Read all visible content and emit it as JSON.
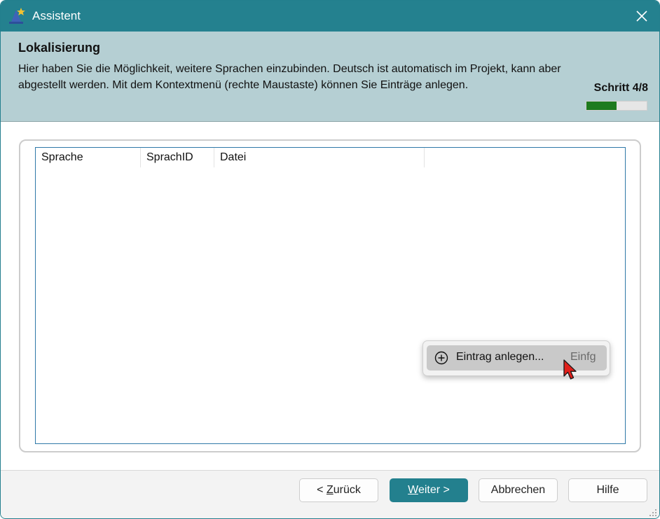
{
  "window": {
    "title": "Assistent",
    "app_icon": "wizard-hat-icon",
    "close_icon": "close-icon"
  },
  "header": {
    "title": "Lokalisierung",
    "description": "Hier haben Sie die Möglichkeit, weitere Sprachen einzubinden. Deutsch ist automatisch im Projekt, kann aber abgestellt werden. Mit dem Kontextmenü (rechte Maustaste) können Sie Einträge anlegen.",
    "step_label": "Schritt 4/8",
    "progress": {
      "current": 4,
      "total": 8
    }
  },
  "list": {
    "columns": [
      "Sprache",
      "SprachID",
      "Datei"
    ],
    "rows": []
  },
  "context_menu": {
    "items": [
      {
        "icon": "plus-circle-icon",
        "label": "Eintrag anlegen...",
        "shortcut": "Einfg",
        "highlighted": true
      }
    ]
  },
  "footer": {
    "buttons": {
      "back": {
        "prefix": "< ",
        "mnemonic": "Z",
        "rest": "urück"
      },
      "next": {
        "mnemonic": "W",
        "rest": "eiter >"
      },
      "cancel": "Abbrechen",
      "help": "Hilfe"
    }
  },
  "colors": {
    "titlebar": "#24818f",
    "header_bg": "#b5cfd3",
    "progress_fill": "#1e7b1e",
    "primary_button": "#23808e",
    "list_border": "#2f79a8",
    "cursor": "#e0201b"
  }
}
